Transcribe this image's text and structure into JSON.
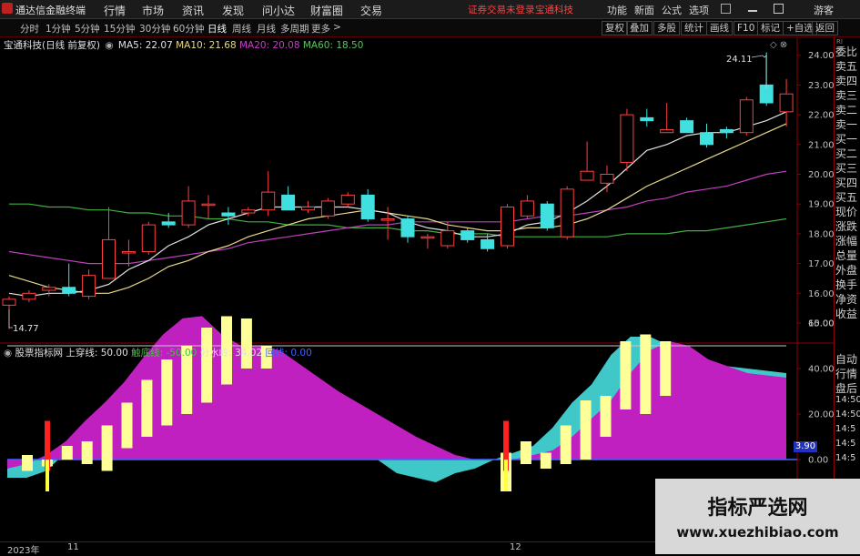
{
  "app": {
    "title": "通达信金融终端"
  },
  "menu": [
    "行情",
    "市场",
    "资讯",
    "发现",
    "问小达",
    "财富圈",
    "交易"
  ],
  "notice": {
    "left": "证券交易未登录",
    "right": "宝通科技"
  },
  "menu_right": [
    "功能",
    "新面",
    "公式",
    "选项",
    "游客"
  ],
  "periods": [
    "分时",
    "1分钟",
    "5分钟",
    "15分钟",
    "30分钟",
    "60分钟",
    "日线",
    "周线",
    "月线",
    "多周期",
    "更多"
  ],
  "active_period": "日线",
  "toolbar": [
    "复权",
    "叠加",
    "多股",
    "统计",
    "画线",
    "F10",
    "标记",
    "+自选",
    "返回"
  ],
  "main_chart": {
    "title": "宝通科技(日线 前复权)",
    "ma": [
      {
        "label": "MA5: 22.07",
        "color": "#e0e0e0"
      },
      {
        "label": "MA10: 21.68",
        "color": "#e6d98a"
      },
      {
        "label": "MA20: 20.08",
        "color": "#c040c0"
      },
      {
        "label": "MA60: 18.50",
        "color": "#60c060"
      }
    ],
    "high_label": "24.11",
    "low_label": "14.77",
    "ylabels": [
      "24.00",
      "23.00",
      "22.00",
      "21.00",
      "20.00",
      "19.00",
      "18.00",
      "17.00",
      "16.00",
      "15.00"
    ]
  },
  "indicator": {
    "title": "股票指标网",
    "params": [
      {
        "label": "上穿线: 50.00",
        "color": "#e0e0e0"
      },
      {
        "label": "触底线: -50.00",
        "color": "#40c040"
      },
      {
        "label": "分水岭: 34.02",
        "color": "#e0e0e0"
      },
      {
        "label": "回线: 0.00",
        "color": "#4060ff"
      }
    ],
    "ylabels": [
      "60.00",
      "40.00",
      "20.00",
      "0.00"
    ],
    "current_value": "3.90"
  },
  "dates": {
    "year": "2023年",
    "nov": "11",
    "dec": "12"
  },
  "side_panel": [
    "委比",
    "卖五",
    "卖四",
    "卖三",
    "卖二",
    "卖一",
    "买一",
    "买二",
    "买三",
    "买四",
    "买五",
    "现价",
    "涨跌",
    "涨幅",
    "总量",
    "外盘",
    "换手",
    "净资",
    "收益",
    "自动",
    "行情",
    "盘后",
    "14:50",
    "14:50",
    "14:5",
    "14:5",
    "14:5"
  ],
  "watermark": {
    "title": "指标严选网",
    "url": "www.xuezhibiao.com"
  },
  "chart_data": [
    {
      "type": "candlestick",
      "title": "宝通科技(日线 前复权)",
      "ylim": [
        14.5,
        24.5
      ],
      "candles": [
        {
          "o": 15.6,
          "h": 15.9,
          "l": 14.8,
          "c": 15.8
        },
        {
          "o": 15.8,
          "h": 16.1,
          "l": 15.7,
          "c": 16.0
        },
        {
          "o": 16.1,
          "h": 16.3,
          "l": 15.9,
          "c": 16.2
        },
        {
          "o": 16.2,
          "h": 17.0,
          "l": 15.9,
          "c": 16.0
        },
        {
          "o": 15.9,
          "h": 16.8,
          "l": 15.8,
          "c": 16.6
        },
        {
          "o": 16.5,
          "h": 18.9,
          "l": 16.5,
          "c": 17.8
        },
        {
          "o": 17.4,
          "h": 17.8,
          "l": 16.9,
          "c": 17.4
        },
        {
          "o": 17.4,
          "h": 18.4,
          "l": 17.3,
          "c": 18.3
        },
        {
          "o": 18.4,
          "h": 18.7,
          "l": 18.2,
          "c": 18.3
        },
        {
          "o": 18.3,
          "h": 19.6,
          "l": 18.2,
          "c": 19.1
        },
        {
          "o": 19.0,
          "h": 19.3,
          "l": 18.5,
          "c": 19.0
        },
        {
          "o": 18.7,
          "h": 18.9,
          "l": 18.3,
          "c": 18.6
        },
        {
          "o": 18.7,
          "h": 18.9,
          "l": 18.6,
          "c": 18.8
        },
        {
          "o": 18.8,
          "h": 20.1,
          "l": 18.6,
          "c": 19.4
        },
        {
          "o": 19.3,
          "h": 19.6,
          "l": 18.8,
          "c": 18.8
        },
        {
          "o": 18.8,
          "h": 19.1,
          "l": 18.7,
          "c": 18.9
        },
        {
          "o": 18.6,
          "h": 19.2,
          "l": 18.5,
          "c": 19.1
        },
        {
          "o": 19.0,
          "h": 19.4,
          "l": 18.9,
          "c": 19.3
        },
        {
          "o": 19.3,
          "h": 19.5,
          "l": 18.4,
          "c": 18.5
        },
        {
          "o": 18.5,
          "h": 18.9,
          "l": 17.8,
          "c": 18.5
        },
        {
          "o": 18.5,
          "h": 18.6,
          "l": 17.7,
          "c": 17.9
        },
        {
          "o": 17.9,
          "h": 18.0,
          "l": 17.5,
          "c": 17.9
        },
        {
          "o": 17.6,
          "h": 18.4,
          "l": 17.5,
          "c": 18.1
        },
        {
          "o": 18.1,
          "h": 18.2,
          "l": 17.7,
          "c": 17.8
        },
        {
          "o": 17.8,
          "h": 18.0,
          "l": 17.4,
          "c": 17.5
        },
        {
          "o": 17.6,
          "h": 19.0,
          "l": 17.5,
          "c": 18.9
        },
        {
          "o": 18.6,
          "h": 19.3,
          "l": 18.5,
          "c": 19.1
        },
        {
          "o": 19.0,
          "h": 19.1,
          "l": 18.1,
          "c": 18.2
        },
        {
          "o": 17.9,
          "h": 19.6,
          "l": 17.8,
          "c": 19.5
        },
        {
          "o": 19.8,
          "h": 21.1,
          "l": 19.8,
          "c": 20.1
        },
        {
          "o": 19.7,
          "h": 20.3,
          "l": 19.4,
          "c": 20.0
        },
        {
          "o": 20.4,
          "h": 22.2,
          "l": 20.1,
          "c": 22.0
        },
        {
          "o": 21.9,
          "h": 22.2,
          "l": 21.6,
          "c": 21.8
        },
        {
          "o": 21.4,
          "h": 22.4,
          "l": 21.4,
          "c": 21.5
        },
        {
          "o": 21.8,
          "h": 21.9,
          "l": 21.4,
          "c": 21.4
        },
        {
          "o": 21.4,
          "h": 21.7,
          "l": 20.9,
          "c": 21.0
        },
        {
          "o": 21.5,
          "h": 21.6,
          "l": 21.2,
          "c": 21.4
        },
        {
          "o": 21.4,
          "h": 22.6,
          "l": 21.3,
          "c": 22.5
        },
        {
          "o": 23.0,
          "h": 24.1,
          "l": 22.3,
          "c": 22.4
        },
        {
          "o": 22.1,
          "h": 23.2,
          "l": 21.6,
          "c": 22.7
        }
      ],
      "ma": {
        "MA5": [
          16.0,
          15.9,
          16.0,
          16.0,
          16.1,
          16.3,
          16.8,
          17.1,
          17.6,
          17.9,
          18.3,
          18.5,
          18.7,
          18.9,
          18.9,
          18.9,
          18.9,
          18.9,
          18.8,
          18.7,
          18.4,
          18.2,
          18.1,
          17.9,
          17.9,
          18.0,
          18.3,
          18.4,
          18.7,
          19.1,
          19.6,
          20.2,
          20.8,
          21.0,
          21.3,
          21.4,
          21.4,
          21.6,
          21.8,
          22.1
        ],
        "MA10": [
          16.6,
          16.4,
          16.2,
          16.1,
          16.0,
          16.0,
          16.2,
          16.5,
          16.9,
          17.1,
          17.4,
          17.6,
          17.9,
          18.1,
          18.3,
          18.5,
          18.6,
          18.7,
          18.8,
          18.7,
          18.6,
          18.5,
          18.3,
          18.2,
          18.1,
          18.1,
          18.2,
          18.2,
          18.3,
          18.5,
          18.8,
          19.2,
          19.6,
          19.9,
          20.2,
          20.5,
          20.8,
          21.1,
          21.4,
          21.7
        ],
        "MA20": [
          17.4,
          17.3,
          17.2,
          17.1,
          17.0,
          17.0,
          17.0,
          17.1,
          17.2,
          17.3,
          17.4,
          17.5,
          17.7,
          17.8,
          17.9,
          18.0,
          18.1,
          18.2,
          18.3,
          18.3,
          18.4,
          18.4,
          18.4,
          18.4,
          18.4,
          18.4,
          18.5,
          18.6,
          18.6,
          18.7,
          18.8,
          18.9,
          19.1,
          19.2,
          19.4,
          19.5,
          19.6,
          19.8,
          20.0,
          20.1
        ],
        "MA60": [
          19.0,
          19.0,
          18.9,
          18.9,
          18.8,
          18.8,
          18.7,
          18.7,
          18.6,
          18.6,
          18.5,
          18.5,
          18.4,
          18.4,
          18.3,
          18.3,
          18.3,
          18.2,
          18.2,
          18.2,
          18.1,
          18.1,
          18.0,
          18.0,
          18.0,
          17.9,
          17.9,
          17.9,
          17.9,
          17.9,
          17.9,
          18.0,
          18.0,
          18.0,
          18.1,
          18.1,
          18.2,
          18.3,
          18.4,
          18.5
        ]
      }
    },
    {
      "type": "area",
      "title": "股票指标网",
      "ylim": [
        -10,
        65
      ],
      "levels": [
        {
          "name": "上穿线",
          "value": 50
        },
        {
          "name": "回线",
          "value": 0
        }
      ],
      "magenta": [
        -4,
        -2,
        2,
        8,
        17,
        25,
        34,
        45,
        55,
        62,
        63,
        55,
        50,
        50,
        48,
        42,
        36,
        30,
        25,
        20,
        15,
        10,
        6,
        2,
        0,
        0,
        0,
        2,
        4,
        10,
        18,
        26,
        38,
        48,
        52,
        50,
        44,
        41,
        38,
        37,
        36
      ],
      "cyan": [
        -8,
        -8,
        -5,
        3,
        15,
        23,
        33,
        44,
        54,
        62,
        63,
        55,
        50,
        50,
        44,
        36,
        26,
        18,
        10,
        0,
        -6,
        -8,
        -10,
        -6,
        -4,
        0,
        3,
        6,
        14,
        25,
        33,
        46,
        54,
        54,
        50,
        44,
        40,
        41,
        40,
        39,
        38
      ],
      "bars": [
        {
          "lo": -5,
          "hi": 2
        },
        {
          "lo": -3,
          "hi": 0
        },
        {
          "lo": 0,
          "hi": 6
        },
        {
          "lo": -2,
          "hi": 8
        },
        {
          "lo": -5,
          "hi": 15
        },
        {
          "lo": 5,
          "hi": 25
        },
        {
          "lo": 10,
          "hi": 35
        },
        {
          "lo": 15,
          "hi": 44
        },
        {
          "lo": 20,
          "hi": 50
        },
        {
          "lo": 25,
          "hi": 58
        },
        {
          "lo": 33,
          "hi": 63
        },
        {
          "lo": 40,
          "hi": 62
        },
        {
          "lo": 40,
          "hi": 50
        },
        {
          "lo": -14,
          "hi": 3
        },
        {
          "lo": -2,
          "hi": 8
        },
        {
          "lo": -4,
          "hi": 3
        },
        {
          "lo": -2,
          "hi": 15
        },
        {
          "lo": 0,
          "hi": 26
        },
        {
          "lo": 10,
          "hi": 28
        },
        {
          "lo": 22,
          "hi": 52
        },
        {
          "lo": 20,
          "hi": 55
        },
        {
          "lo": 28,
          "hi": 52
        }
      ],
      "signals": [
        {
          "index": 2,
          "lo": -5,
          "hi": 17
        },
        {
          "index": 25,
          "lo": -5,
          "hi": 17
        }
      ]
    }
  ]
}
